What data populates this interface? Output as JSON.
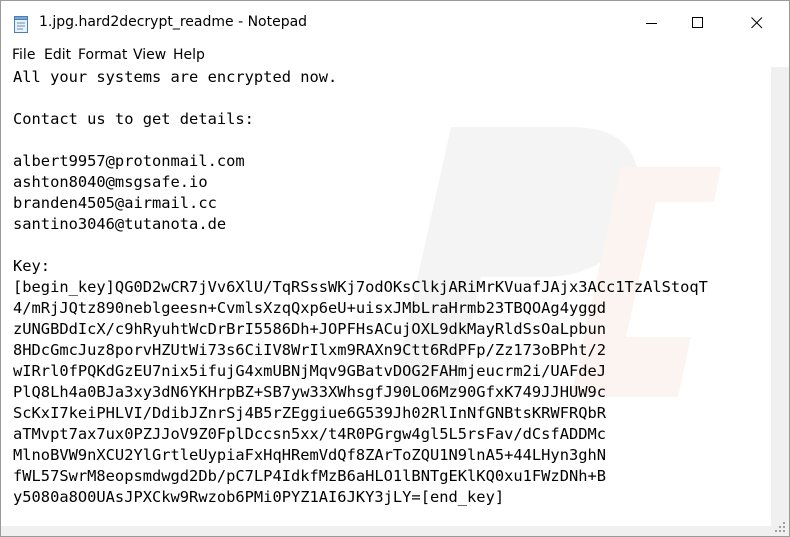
{
  "window": {
    "title": "1.jpg.hard2decrypt_readme - Notepad",
    "controls": [
      "minimize-icon",
      "maximize-icon",
      "close-icon"
    ]
  },
  "menu": {
    "file": "File",
    "edit": "Edit",
    "format": "Format",
    "view": "View",
    "help": "Help"
  },
  "document": {
    "text": "All your systems are encrypted now.\n\nContact us to get details:\n\nalbert9957@protonmail.com\nashton8040@msgsafe.io\nbranden4505@airmail.cc\nsantino3046@tutanota.de\n\nKey:\n[begin_key]QG0D2wCR7jVv6XlU/TqRSssWKj7odOKsClkjARiMrKVuafJAjx3ACc1TzAlStoqT\n4/mRjJQtz890neblgeesn+CvmlsXzqQxp6eU+uisxJMbLraHrmb23TBQOAg4yggd\nzUNGBDdIcX/c9hRyuhtWcDrBrI5586Dh+JOPFHsACujOXL9dkMayRldSsOaLpbun\n8HDcGmcJuz8porvHZUtWi73s6CiIV8WrIlxm9RAXn9Ctt6RdPFp/Zz173oBPht/2\nwIRrl0fPQKdGzEU7nix5ifujG4xmUBNjMqv9GBatvDOG2FAHmjeucrm2i/UAFdeJ\nPlQ8Lh4a0BJa3xy3dN6YKHrpBZ+SB7yw33XWhsgfJ90LO6Mz90GfxK749JJHUW9c\nScKxI7keiPHLVI/DdibJZnrSj4B5rZEggiue6G539Jh02RlInNfGNBtsKRWFRQbR\naTMvpt7ax7ux0PZJJoV9Z0FplDccsn5xx/t4R0PGrgw4gl5L5rsFav/dCsfADDMc\nMlnoBVW9nXCU2YlGrtleUypiaFxHqHRemVdQf8ZArToZQU1N9lnA5+44LHyn3ghN\nfWL57SwrM8eopsmdwgd2Db/pC7LP4IdkfMzB6aHLO1lBNTgEKlKQ0xu1FWzDNh+B\ny5080a8O0UAsJPXCkw9Rwzob6PMi0PYZ1AI6JKY3jLY=[end_key]"
  },
  "colors": {
    "background": "#ffffff",
    "text": "#000000",
    "scrollbar": "#f0f0f0",
    "border": "#9a9a9a"
  }
}
